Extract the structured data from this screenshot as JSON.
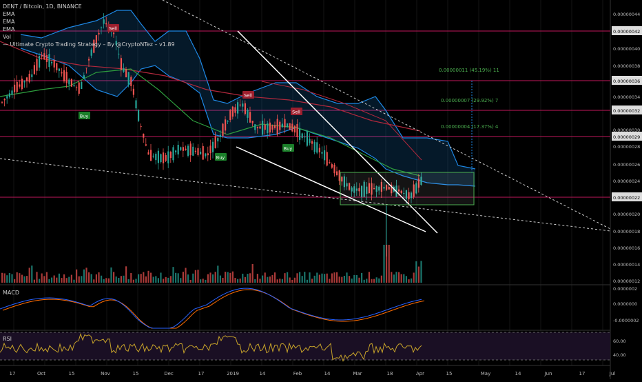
{
  "legend": {
    "title": "DENT / Bitcoin, 1D, BINANCE",
    "ema1": "EMA",
    "ema2": "EMA",
    "ema3": "EMA",
    "vol": "Vol",
    "strategy": "— Ultimate Crypto Trading Strategy – By @CryptoNTez – v1.89"
  },
  "panes": {
    "macd": "MACD",
    "rsi": "RSI"
  },
  "colors": {
    "background": "#000000",
    "up": "#26a69a",
    "down": "#ef5350",
    "cloud": "#1e88e5",
    "ema_green": "#2e9e3e",
    "ema_red": "#b0283c",
    "hline": "#c2185b",
    "fib": "#4caf50",
    "macd": "#2962ff",
    "signal": "#ff6d00",
    "rsi": "#c8a42a"
  },
  "chart_data": [
    {
      "type": "candlestick",
      "title": "DENT / Bitcoin, 1D, BINANCE",
      "x_ticks": [
        "17",
        "Oct",
        "15",
        "Nov",
        "15",
        "Dec",
        "17",
        "2019",
        "14",
        "Feb",
        "14",
        "Mar",
        "18",
        "Apr",
        "15",
        "May",
        "14",
        "Jun",
        "17",
        "Jul"
      ],
      "y_ticks": [
        "0.00000044",
        "0.00000042",
        "0.00000040",
        "0.00000038",
        "0.00000036",
        "0.00000034",
        "0.00000032",
        "0.00000030",
        "0.00000029",
        "0.00000028",
        "0.00000026",
        "0.00000024",
        "0.00000022",
        "0.00000020",
        "0.00000018",
        "0.00000016",
        "0.00000014",
        "0.00000012"
      ],
      "highlighted_levels": [
        "0.00000042",
        "0.00000036",
        "0.00000032",
        "0.00000029",
        "0.00000022"
      ],
      "signals": [
        {
          "label": "Sell",
          "date": "Nov"
        },
        {
          "label": "Buy",
          "date": "Oct 25"
        },
        {
          "label": "Buy",
          "date": "Dec 25"
        },
        {
          "label": "Sell",
          "date": "Jan 02"
        },
        {
          "label": "Sell",
          "date": "Feb"
        },
        {
          "label": "Buy",
          "date": "Jan 28"
        }
      ],
      "measurements": [
        {
          "text": "0.00000011  (45.19%)  11"
        },
        {
          "text": "0.00000007  (29.92%)  7"
        },
        {
          "text": "0.00000004  (17.37%)  4"
        }
      ]
    },
    {
      "type": "line",
      "title": "MACD",
      "y_ticks": [
        "0.0000002",
        "0.0000000",
        "-0.0000002"
      ]
    },
    {
      "type": "line",
      "title": "RSI",
      "y_ticks": [
        "60.00",
        "40.00"
      ]
    }
  ]
}
